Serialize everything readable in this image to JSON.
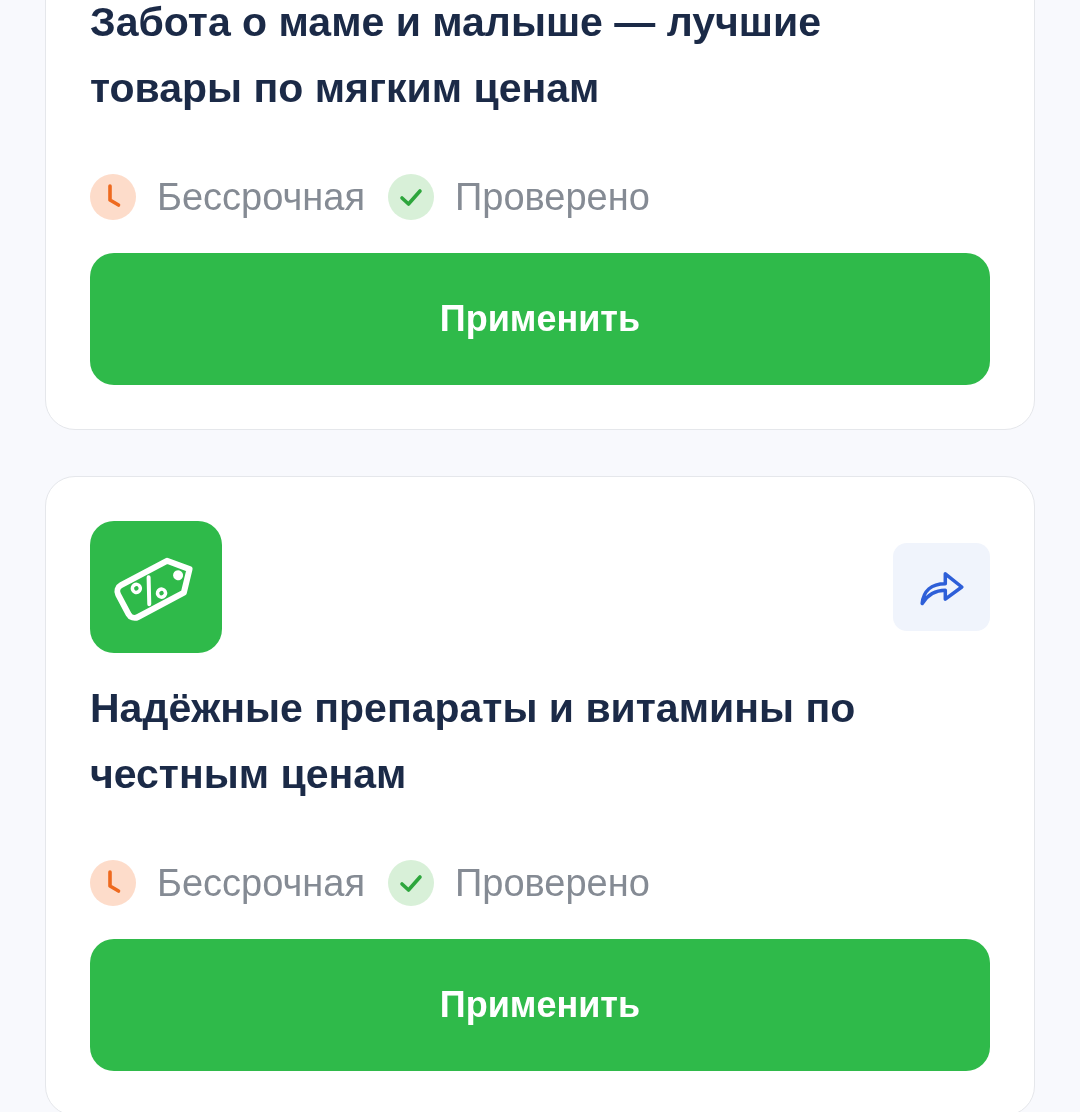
{
  "cards": [
    {
      "title": "Забота о маме и малыше — лучшие товары по мягким ценам",
      "meta": [
        {
          "kind": "term",
          "label": "Бессрочная"
        },
        {
          "kind": "verified",
          "label": "Проверено"
        }
      ],
      "button": "Применить"
    },
    {
      "header": {
        "kind": "discount",
        "share_button": true
      },
      "title": "Надёжные препараты и витамины по честным ценам",
      "meta": [
        {
          "kind": "term",
          "label": "Бессрочная"
        },
        {
          "kind": "verified",
          "label": "Проверено"
        }
      ],
      "button": "Применить"
    }
  ]
}
